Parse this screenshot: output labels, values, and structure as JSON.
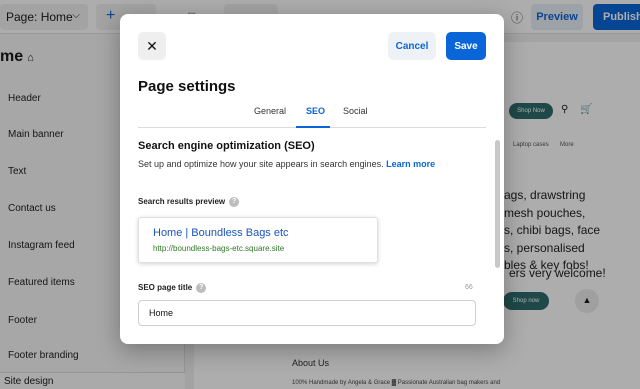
{
  "topbar": {
    "page_select": "Page: Home",
    "add_symbol": "+",
    "preview": "Preview",
    "publish": "Publish"
  },
  "sidebar": {
    "title": "me",
    "items": [
      {
        "label": "Header"
      },
      {
        "label": "Main banner"
      },
      {
        "label": "Text"
      },
      {
        "label": "Contact us"
      },
      {
        "label": "Instagram feed"
      },
      {
        "label": "Featured items"
      },
      {
        "label": "Footer"
      },
      {
        "label": "Footer branding"
      }
    ],
    "footer": "Site design"
  },
  "site": {
    "shop_now": "Shop Now",
    "nav": [
      "Laptop cases",
      "More"
    ],
    "lines": [
      "ags, drawstring",
      "mesh pouches,",
      "s, chibi bags, face",
      "s, personalised",
      "bles & key fobs!",
      "ers very welcome!"
    ],
    "shop_now_2": "Shop now",
    "about_title": "About Us",
    "about_text": "100% Handmade by Angela & Grace ▓ Passionate Australian bag makers and"
  },
  "modal": {
    "title": "Page settings",
    "cancel": "Cancel",
    "save": "Save",
    "tabs": [
      {
        "label": "General",
        "active": false
      },
      {
        "label": "SEO",
        "active": true
      },
      {
        "label": "Social",
        "active": false
      }
    ],
    "seo": {
      "heading": "Search engine optimization (SEO)",
      "description": "Set up and optimize how your site appears in search engines.",
      "learn_more": "Learn more",
      "preview_label": "Search results preview",
      "preview_title": "Home | Boundless Bags etc",
      "preview_url": "http://boundless-bags-etc.square.site",
      "page_title_label": "SEO page title",
      "page_title_count": "66",
      "page_title_value": "Home"
    }
  },
  "colors": {
    "accent": "#0a66d8",
    "site_button": "#2f6b6a",
    "preview_link": "#1a55b9",
    "preview_url": "#2f7a27"
  },
  "icons": [
    "close-icon",
    "help-icon",
    "home-icon",
    "chevron-down-icon",
    "search-icon",
    "cart-icon"
  ]
}
